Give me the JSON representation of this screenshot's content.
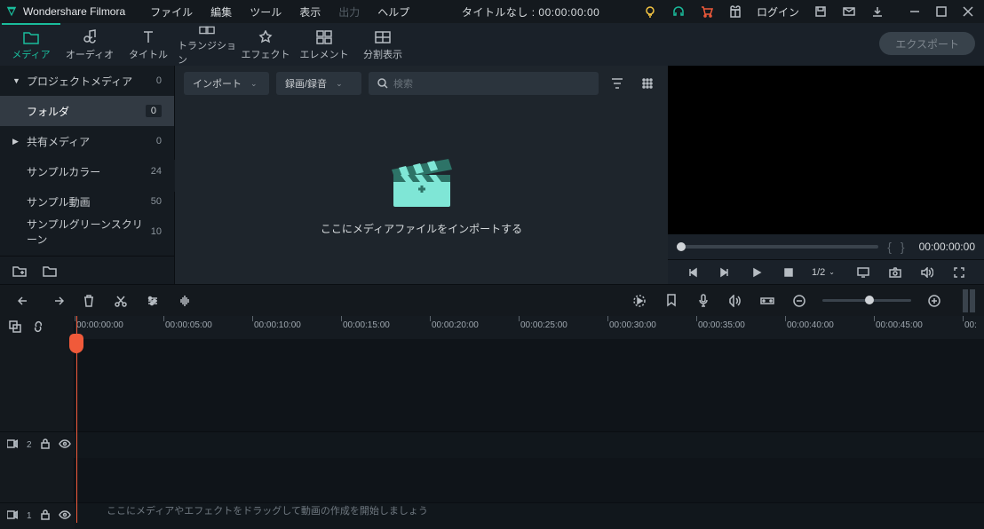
{
  "app": {
    "name": "Wondershare Filmora"
  },
  "menu": {
    "items": [
      "ファイル",
      "編集",
      "ツール",
      "表示",
      "出力",
      "ヘルプ"
    ],
    "disabled_index": 4
  },
  "title": {
    "text": "タイトルなし : 00:00:00:00"
  },
  "menubar_right": {
    "login": "ログイン"
  },
  "tabs": {
    "items": [
      {
        "label": "メディア"
      },
      {
        "label": "オーディオ"
      },
      {
        "label": "タイトル"
      },
      {
        "label": "トランジション"
      },
      {
        "label": "エフェクト"
      },
      {
        "label": "エレメント"
      },
      {
        "label": "分割表示"
      }
    ],
    "active_index": 0,
    "export": "エクスポート"
  },
  "sidebar": {
    "rows": [
      {
        "label": "プロジェクトメディア",
        "count": "0",
        "expandable": true,
        "expanded": true
      },
      {
        "label": "フォルダ",
        "count": "0",
        "selected": true,
        "indent": true
      },
      {
        "label": "共有メディア",
        "count": "0",
        "expandable": true,
        "expanded": false
      },
      {
        "label": "サンプルカラー",
        "count": "24",
        "indent": true
      },
      {
        "label": "サンプル動画",
        "count": "50",
        "indent": true
      },
      {
        "label": "サンプルグリーンスクリーン",
        "count": "10",
        "indent": true
      }
    ]
  },
  "media": {
    "import_dd": "インポート",
    "record_dd": "録画/録音",
    "search_placeholder": "検索",
    "message": "ここにメディアファイルをインポートする"
  },
  "preview": {
    "timecode": "00:00:00:00",
    "speed": "1/2"
  },
  "ruler": {
    "marks": [
      "00:00:00:00",
      "00:00:05:00",
      "00:00:10:00",
      "00:00:15:00",
      "00:00:20:00",
      "00:00:25:00",
      "00:00:30:00",
      "00:00:35:00",
      "00:00:40:00",
      "00:00:45:00",
      "00:"
    ]
  },
  "tracks": {
    "video2": "2",
    "video1": "1",
    "hint": "ここにメディアやエフェクトをドラッグして動画の作成を開始しましょう"
  }
}
